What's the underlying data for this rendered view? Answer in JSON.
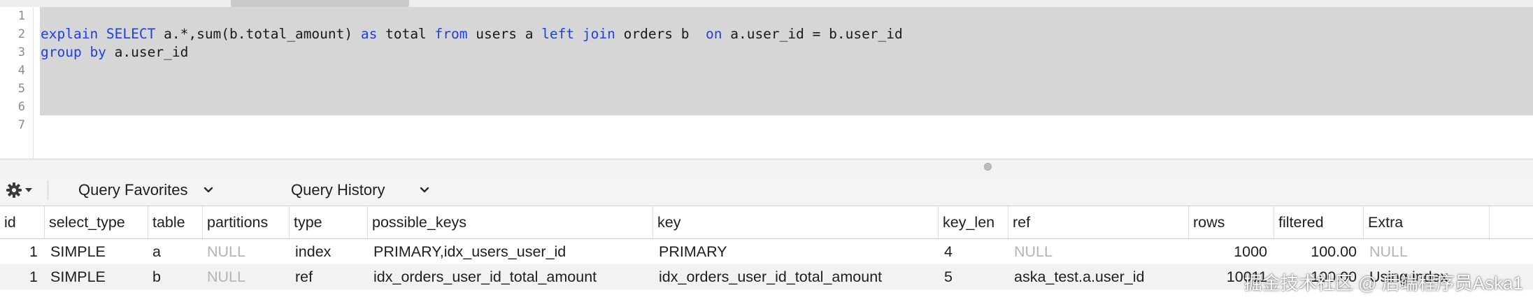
{
  "editor": {
    "line_numbers": [
      "1",
      "2",
      "3",
      "4",
      "5",
      "6",
      "7"
    ],
    "lines": [
      [],
      [
        {
          "t": "explain SELECT",
          "k": true
        },
        {
          "t": " a.*,sum(b.total_amount) ",
          "k": false
        },
        {
          "t": "as",
          "k": true
        },
        {
          "t": " total ",
          "k": false
        },
        {
          "t": "from",
          "k": true
        },
        {
          "t": " users a ",
          "k": false
        },
        {
          "t": "left join",
          "k": true
        },
        {
          "t": " orders b  ",
          "k": false
        },
        {
          "t": "on",
          "k": true
        },
        {
          "t": " a.user_id = b.user_id",
          "k": false
        }
      ],
      [
        {
          "t": "group by",
          "k": true
        },
        {
          "t": " a.user_id",
          "k": false
        }
      ],
      [],
      [],
      [],
      []
    ]
  },
  "toolbar": {
    "favorites_label": "Query Favorites",
    "history_label": "Query History"
  },
  "results": {
    "columns": [
      "id",
      "select_type",
      "table",
      "partitions",
      "type",
      "possible_keys",
      "key",
      "key_len",
      "ref",
      "rows",
      "filtered",
      "Extra"
    ],
    "rows": [
      [
        "1",
        "SIMPLE",
        "a",
        "NULL",
        "index",
        "PRIMARY,idx_users_user_id",
        "PRIMARY",
        "4",
        "NULL",
        "1000",
        "100.00",
        "NULL"
      ],
      [
        "1",
        "SIMPLE",
        "b",
        "NULL",
        "ref",
        "idx_orders_user_id_total_amount",
        "idx_orders_user_id_total_amount",
        "5",
        "aska_test.a.user_id",
        "10011",
        "100.00",
        "Using index"
      ]
    ]
  },
  "watermark": "掘金技术社区 @ 后端程序员Aska1",
  "colors": {
    "keyword": "#1f3fe0",
    "selection": "#d6d6d6",
    "null_text": "#b4b4b4",
    "alt_row": "#f2f2f2"
  },
  "icons": {
    "gear": "gear-icon",
    "dropdown": "chevron-down-icon"
  }
}
